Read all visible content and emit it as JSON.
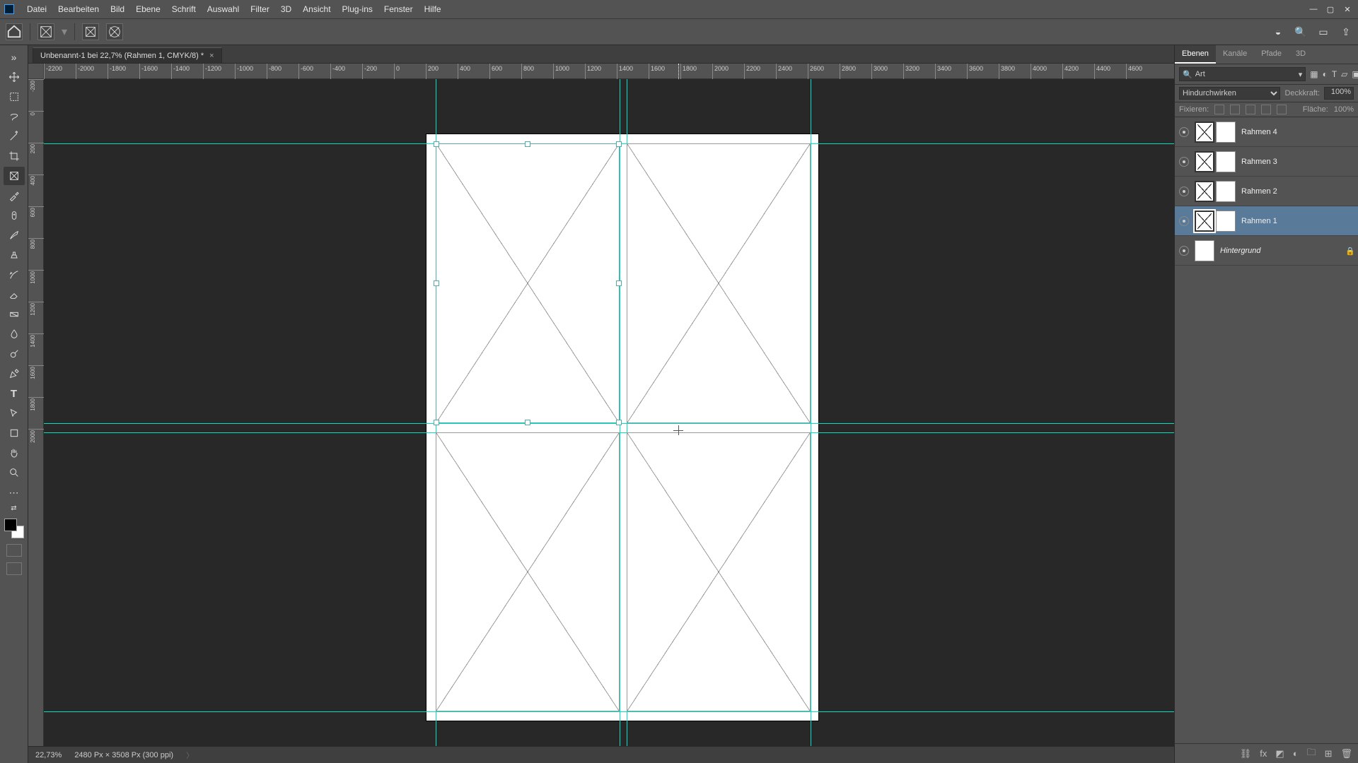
{
  "menu": [
    "Datei",
    "Bearbeiten",
    "Bild",
    "Ebene",
    "Schrift",
    "Auswahl",
    "Filter",
    "3D",
    "Ansicht",
    "Plug-ins",
    "Fenster",
    "Hilfe"
  ],
  "document": {
    "tab_title": "Unbenannt-1 bei 22,7% (Rahmen 1, CMYK/8) *",
    "zoom": "22,73%",
    "info": "2480 Px × 3508 Px (300 ppi)"
  },
  "ruler": {
    "h": [
      "-2200",
      "-2000",
      "-1800",
      "-1600",
      "-1400",
      "-1200",
      "-1000",
      "-800",
      "-600",
      "-400",
      "-200",
      "0",
      "200",
      "400",
      "600",
      "800",
      "1000",
      "1200",
      "1400",
      "1600",
      "1800",
      "2000",
      "2200",
      "2400",
      "2600",
      "2800",
      "3000",
      "3200",
      "3400",
      "3600",
      "3800",
      "4000",
      "4200",
      "4400",
      "4600"
    ],
    "v": [
      "-200",
      "0",
      "200",
      "400",
      "600",
      "800",
      "1000",
      "1200",
      "1400",
      "1600",
      "1800",
      "2000"
    ]
  },
  "panels": {
    "tabs": [
      "Ebenen",
      "Kanäle",
      "Pfade",
      "3D"
    ],
    "search_kind": "Art",
    "blend_mode": "Hindurchwirken",
    "opacity_label": "Deckkraft:",
    "opacity_value": "100%",
    "lock_label": "Fixieren:",
    "fill_label": "Fläche:",
    "fill_value": "100%",
    "layers": [
      {
        "name": "Rahmen 4",
        "kind": "frame",
        "selected": false,
        "locked": false
      },
      {
        "name": "Rahmen 3",
        "kind": "frame",
        "selected": false,
        "locked": false
      },
      {
        "name": "Rahmen 2",
        "kind": "frame",
        "selected": false,
        "locked": false
      },
      {
        "name": "Rahmen 1",
        "kind": "frame",
        "selected": true,
        "locked": false
      },
      {
        "name": "Hintergrund",
        "kind": "bg",
        "selected": false,
        "locked": true
      }
    ]
  }
}
